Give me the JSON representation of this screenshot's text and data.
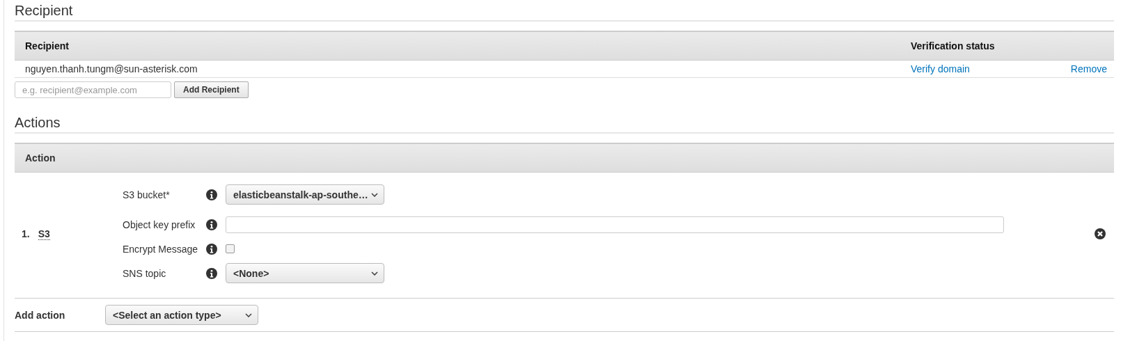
{
  "recipient_section": {
    "title": "Recipient",
    "table": {
      "columns": [
        "Recipient",
        "Verification status"
      ],
      "rows": [
        {
          "recipient": "nguyen.thanh.tungm@sun-asterisk.com",
          "verification_link": "Verify domain",
          "remove_link": "Remove"
        }
      ]
    },
    "new_recipient": {
      "placeholder": "e.g. recipient@example.com"
    },
    "add_button": "Add Recipient"
  },
  "actions_section": {
    "title": "Actions",
    "table": {
      "columns": [
        "Action"
      ],
      "actions": [
        {
          "number": "1.",
          "name": "S3",
          "fields": [
            {
              "kind": "select",
              "label": "S3 bucket*",
              "value": "elasticbeanstalk-ap-southe…"
            },
            {
              "kind": "text",
              "label": "Object key prefix"
            },
            {
              "kind": "checkbox",
              "label": "Encrypt Message",
              "checked": false
            },
            {
              "kind": "select",
              "label": "SNS topic",
              "value": "<None>"
            }
          ]
        }
      ]
    },
    "add_action": {
      "label": "Add action",
      "select": "<Select an action type>"
    }
  }
}
